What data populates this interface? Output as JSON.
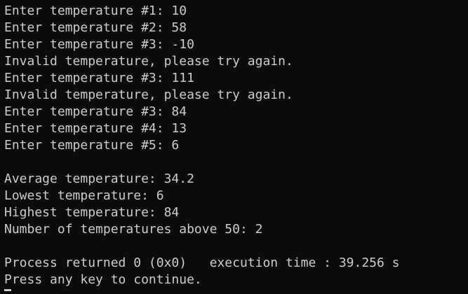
{
  "console": {
    "lines": [
      "Enter temperature #1: 10",
      "Enter temperature #2: 58",
      "Enter temperature #3: -10",
      "Invalid temperature, please try again.",
      "Enter temperature #3: 111",
      "Invalid temperature, please try again.",
      "Enter temperature #3: 84",
      "Enter temperature #4: 13",
      "Enter temperature #5: 6",
      "",
      "Average temperature: 34.2",
      "Lowest temperature: 6",
      "Highest temperature: 84",
      "Number of temperatures above 50: 2",
      "",
      "Process returned 0 (0x0)   execution time : 39.256 s",
      "Press any key to continue."
    ]
  },
  "colors": {
    "background": "#0c0c0c",
    "foreground": "#cccccc"
  }
}
